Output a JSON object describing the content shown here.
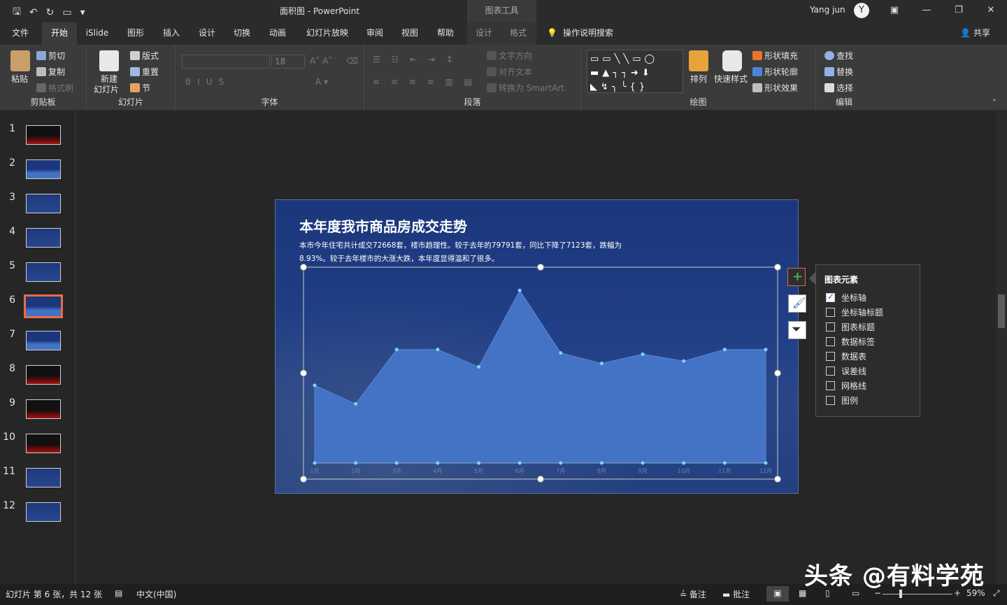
{
  "titlebar": {
    "doc_title": "面积图 - PowerPoint",
    "context_tools": "图表工具",
    "user_name": "Yang jun",
    "avatar_initial": "Y"
  },
  "tabs": [
    {
      "label": "文件",
      "x": 0
    },
    {
      "label": "开始",
      "active": true
    },
    {
      "label": "iSlide"
    },
    {
      "label": "图形"
    },
    {
      "label": "插入"
    },
    {
      "label": "设计"
    },
    {
      "label": "切换"
    },
    {
      "label": "动画"
    },
    {
      "label": "幻灯片放映"
    },
    {
      "label": "审阅"
    },
    {
      "label": "视图"
    },
    {
      "label": "帮助"
    },
    {
      "label": "设计",
      "context": true
    },
    {
      "label": "格式",
      "context": true
    }
  ],
  "search_tab": "操作说明搜索",
  "share_label": "共享",
  "ribbon": {
    "clipboard": {
      "label": "剪贴板",
      "paste": "粘贴",
      "cut": "剪切",
      "copy": "复制",
      "format_painter": "格式刷"
    },
    "slides": {
      "label": "幻灯片",
      "new_slide_1": "新建",
      "new_slide_2": "幻灯片",
      "layout": "版式",
      "reset": "重置",
      "section": "节"
    },
    "font": {
      "label": "字体",
      "size": "18"
    },
    "paragraph": {
      "label": "段落",
      "text_direction": "文字方向",
      "align_text": "对齐文本",
      "smartart": "转换为 SmartArt"
    },
    "drawing": {
      "label": "绘图",
      "arrange": "排列",
      "quick_styles": "快速样式",
      "shape_fill": "形状填充",
      "shape_outline": "形状轮廓",
      "shape_effects": "形状效果"
    },
    "editing": {
      "label": "编辑",
      "find": "查找",
      "replace": "替换",
      "select": "选择"
    }
  },
  "slides": [
    {
      "num": "1",
      "style": "dark"
    },
    {
      "num": "2",
      "style": "bluearea"
    },
    {
      "num": "3",
      "style": "blue"
    },
    {
      "num": "4",
      "style": "blue"
    },
    {
      "num": "5",
      "style": "blue"
    },
    {
      "num": "6",
      "style": "bluearea",
      "selected": true
    },
    {
      "num": "7",
      "style": "bluearea"
    },
    {
      "num": "8",
      "style": "dark"
    },
    {
      "num": "9",
      "style": "dark"
    },
    {
      "num": "10",
      "style": "dark"
    },
    {
      "num": "11",
      "style": "blue"
    },
    {
      "num": "12",
      "style": "blue"
    }
  ],
  "slide": {
    "title": "本年度我市商品房成交走势",
    "body": "本市今年住宅共计成交72668套，楼市趋理性。较于去年的79791套，同比下降了7123套，跌幅为8.93%。较于去年楼市的大涨大跌，本年度显得温和了很多。"
  },
  "chart_data": {
    "type": "area",
    "categories": [
      "1月",
      "2月",
      "3月",
      "4月",
      "5月",
      "6月",
      "7月",
      "8月",
      "9月",
      "10月",
      "11月",
      "12月"
    ],
    "series": [
      {
        "values": [
          6700,
          5100,
          9800,
          9800,
          8300,
          14900,
          9500,
          8600,
          9400,
          8800,
          9800,
          9800
        ]
      }
    ],
    "ylim": [
      0,
      16000
    ],
    "color": "#4472c4",
    "legend": "none",
    "grid": false
  },
  "chart_elements": {
    "title": "图表元素",
    "options": [
      {
        "label": "坐标轴",
        "checked": true
      },
      {
        "label": "坐标轴标题",
        "checked": false
      },
      {
        "label": "图表标题",
        "checked": false
      },
      {
        "label": "数据标签",
        "checked": false
      },
      {
        "label": "数据表",
        "checked": false
      },
      {
        "label": "误差线",
        "checked": false
      },
      {
        "label": "网格线",
        "checked": false
      },
      {
        "label": "图例",
        "checked": false
      }
    ]
  },
  "status": {
    "slide_info": "幻灯片 第 6 张，共 12 张",
    "language": "中文(中国)",
    "notes": "备注",
    "comments": "批注",
    "zoom": "59%"
  },
  "watermark": "头条 @有料学苑"
}
